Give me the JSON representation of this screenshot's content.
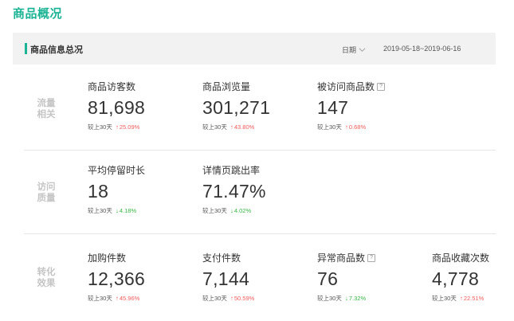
{
  "page": {
    "title": "商品概况"
  },
  "panel": {
    "title": "商品信息总况",
    "date_label": "日期",
    "date_range": "2019-05-18~2019-06-16"
  },
  "sections": [
    {
      "label_line1": "流量",
      "label_line2": "相关",
      "metrics": [
        {
          "name": "商品访客数",
          "value": "81,698",
          "compare_label": "较上30天",
          "direction": "up",
          "change": "25.09%"
        },
        {
          "name": "商品浏览量",
          "value": "301,271",
          "compare_label": "较上30天",
          "direction": "up",
          "change": "43.80%"
        },
        {
          "name": "被访问商品数",
          "value": "147",
          "compare_label": "较上30天",
          "direction": "up",
          "change": "0.68%",
          "help": "?"
        }
      ]
    },
    {
      "label_line1": "访问",
      "label_line2": "质量",
      "metrics": [
        {
          "name": "平均停留时长",
          "value": "18",
          "compare_label": "较上30天",
          "direction": "down",
          "change": "4.18%"
        },
        {
          "name": "详情页跳出率",
          "value": "71.47%",
          "compare_label": "较上30天",
          "direction": "down",
          "change": "4.02%"
        }
      ]
    },
    {
      "label_line1": "转化",
      "label_line2": "效果",
      "metrics": [
        {
          "name": "加购件数",
          "value": "12,366",
          "compare_label": "较上30天",
          "direction": "up",
          "change": "45.96%"
        },
        {
          "name": "支付件数",
          "value": "7,144",
          "compare_label": "较上30天",
          "direction": "up",
          "change": "50.59%"
        },
        {
          "name": "异常商品数",
          "value": "76",
          "compare_label": "较上30天",
          "direction": "down",
          "change": "7.32%",
          "help": "?"
        },
        {
          "name": "商品收藏次数",
          "value": "4,778",
          "compare_label": "较上30天",
          "direction": "up",
          "change": "22.51%"
        }
      ]
    }
  ],
  "colors": {
    "accent": "#1ab394",
    "up": "#f05a5a",
    "down": "#35b544"
  },
  "icons": {
    "up": "arrow-up-icon",
    "down": "arrow-down-icon",
    "help": "help-icon",
    "chevron": "chevron-down-icon"
  }
}
